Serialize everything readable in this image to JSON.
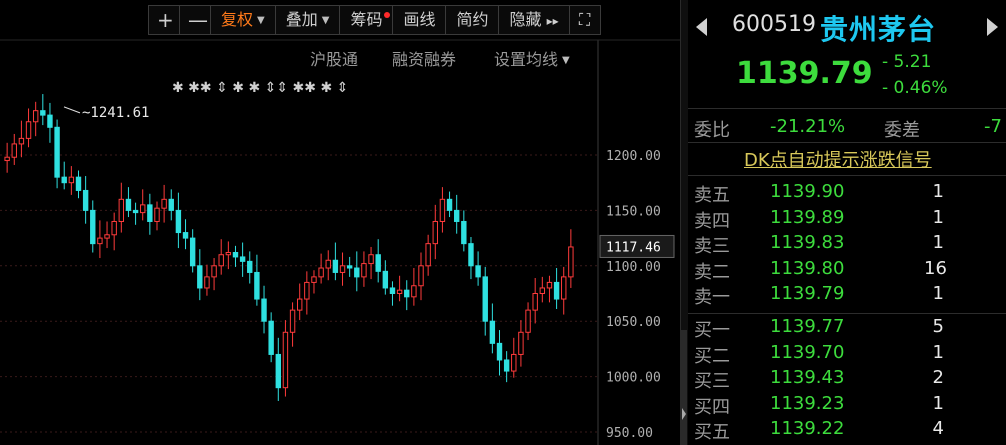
{
  "toolbar": {
    "plus": "+",
    "minus": "—",
    "fuquan": "复权",
    "diejia": "叠加",
    "chouma": "筹码",
    "huaxian": "画线",
    "jianyue": "简约",
    "yincang": "隐藏",
    "more": "▸▸",
    "expand": "⛶"
  },
  "subbar": {
    "hugutong": "沪股通",
    "rongzi": "融资融券",
    "junxian": "设置均线"
  },
  "chart": {
    "high_label": "1241.61",
    "current_tag": "1117.46",
    "y_ticks": [
      "1200.00",
      "1150.00",
      "1100.00",
      "1050.00",
      "1000.00",
      "950.00"
    ],
    "marker_rows": "✱ ✱✱ ⇕   ✱ ✱      ⇕⇕ ✱✱   ✱ ⇕"
  },
  "quote": {
    "code": "600519",
    "name": "贵州茅台",
    "price": "1139.79",
    "change": "- 5.21",
    "change_pct": "- 0.46%",
    "weibi_label": "委比",
    "weibi_value": "-21.21%",
    "weicha_label": "委差",
    "weicha_value": "-7",
    "dk_hint": "DK点自动提示涨跌信号",
    "colors": {
      "down": "#3ddc3d",
      "up": "#ff3b3b",
      "name": "#1ec8f0"
    }
  },
  "asks": [
    {
      "label": "卖五",
      "price": "1139.90",
      "vol": "1"
    },
    {
      "label": "卖四",
      "price": "1139.89",
      "vol": "1"
    },
    {
      "label": "卖三",
      "price": "1139.83",
      "vol": "1"
    },
    {
      "label": "卖二",
      "price": "1139.80",
      "vol": "16"
    },
    {
      "label": "卖一",
      "price": "1139.79",
      "vol": "1"
    }
  ],
  "bids": [
    {
      "label": "买一",
      "price": "1139.77",
      "vol": "5"
    },
    {
      "label": "买二",
      "price": "1139.70",
      "vol": "1"
    },
    {
      "label": "买三",
      "price": "1139.43",
      "vol": "2"
    },
    {
      "label": "买四",
      "price": "1139.23",
      "vol": "1"
    },
    {
      "label": "买五",
      "price": "1139.22",
      "vol": "4"
    }
  ]
}
